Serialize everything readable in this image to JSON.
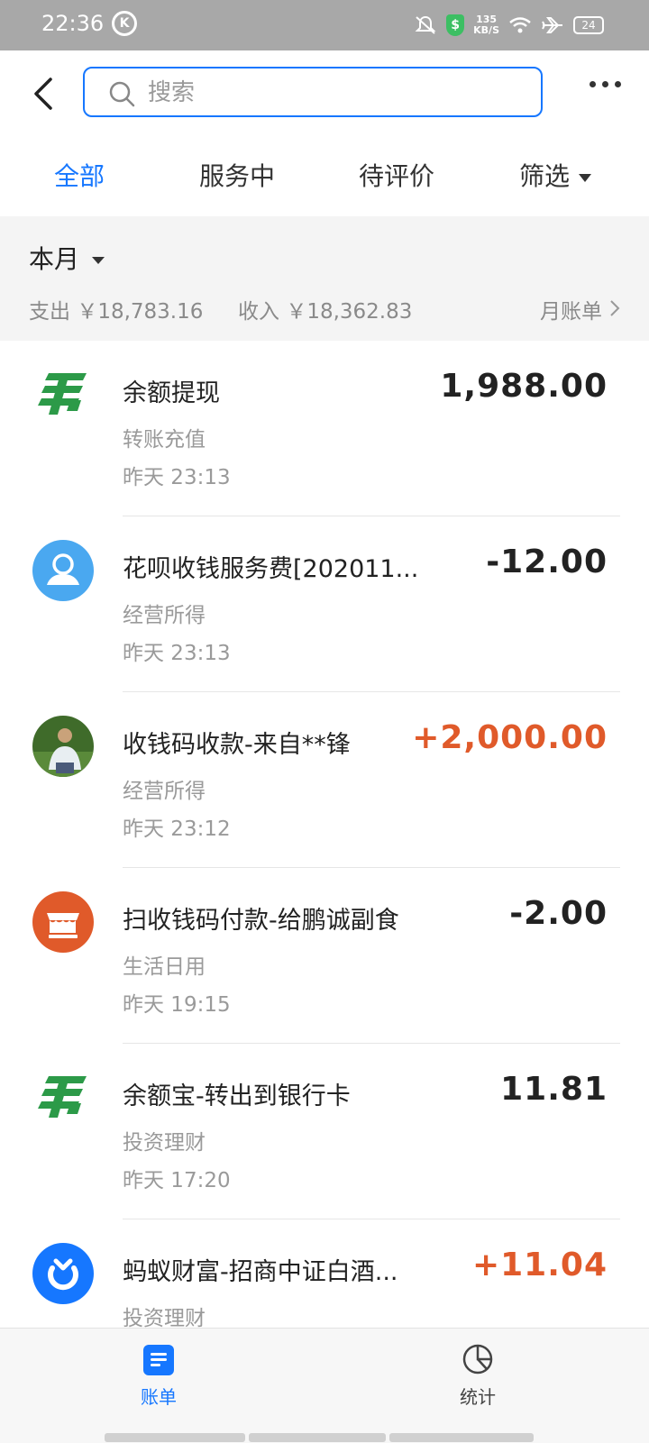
{
  "status_bar": {
    "time": "22:36",
    "k_badge": "K",
    "shield_glyph": "$",
    "speed_value": "135",
    "speed_unit": "KB/S",
    "battery": "24"
  },
  "header": {
    "search_placeholder": "搜索"
  },
  "tabs": [
    {
      "label": "全部",
      "active": true
    },
    {
      "label": "服务中",
      "active": false
    },
    {
      "label": "待评价",
      "active": false
    },
    {
      "label": "筛选",
      "active": false
    }
  ],
  "month": {
    "title": "本月",
    "expense_label": "支出",
    "expense_value": "￥18,783.16",
    "income_label": "收入",
    "income_value": "￥18,362.83",
    "bill_link": "月账单"
  },
  "transactions": [
    {
      "icon": "china-post-icon",
      "title": "余额提现",
      "category": "转账充值",
      "time": "昨天  23:13",
      "amount": "1,988.00",
      "type": "neutral"
    },
    {
      "icon": "user-avatar-icon",
      "title": "花呗收钱服务费[202011...",
      "category": "经营所得",
      "time": "昨天  23:13",
      "amount": "-12.00",
      "type": "expense"
    },
    {
      "icon": "person-photo-avatar",
      "title": "收钱码收款-来自**锋",
      "category": "经营所得",
      "time": "昨天  23:12",
      "amount": "+2,000.00",
      "type": "income"
    },
    {
      "icon": "shop-icon",
      "title": "扫收钱码付款-给鹏诚副食",
      "category": "生活日用",
      "time": "昨天  19:15",
      "amount": "-2.00",
      "type": "expense"
    },
    {
      "icon": "china-post-icon",
      "title": "余额宝-转出到银行卡",
      "category": "投资理财",
      "time": "昨天  17:20",
      "amount": "11.81",
      "type": "neutral"
    },
    {
      "icon": "ant-fortune-icon",
      "title": "蚂蚁财富-招商中证白酒...",
      "category": "投资理财",
      "time": "",
      "amount": "+11.04",
      "type": "income"
    }
  ],
  "colors": {
    "accent": "#1677ff",
    "income": "#e05a2a",
    "post_green": "#2c9a48",
    "shop_orange": "#e05a2a",
    "avatar_blue": "#4aa8f0",
    "ant_blue": "#1677ff"
  },
  "bottom_nav": [
    {
      "label": "账单",
      "icon": "bill-icon",
      "active": true
    },
    {
      "label": "统计",
      "icon": "pie-chart-icon",
      "active": false
    }
  ]
}
